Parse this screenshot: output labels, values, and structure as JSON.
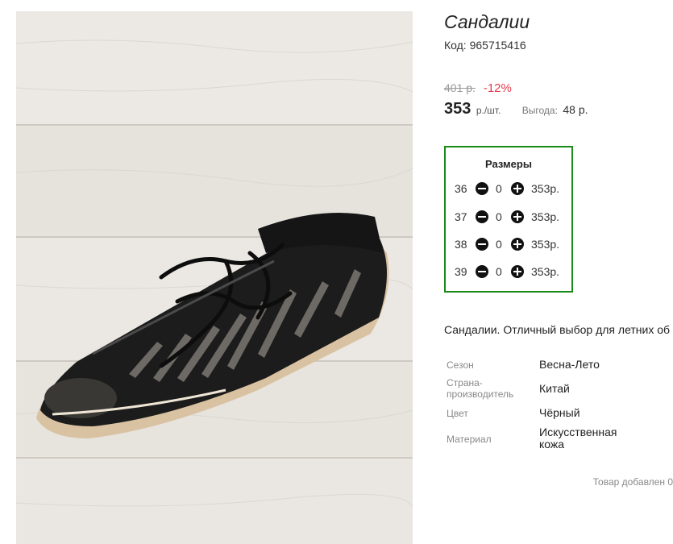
{
  "product": {
    "title": "Сандалии",
    "sku": "Код: 965715416",
    "old_price": "401 р.",
    "discount": "-12%",
    "price": "353",
    "price_unit": "р./шт.",
    "benefit_label": "Выгода:",
    "benefit_value": "48 р.",
    "image_alt": "black leather sandals photo"
  },
  "sizes": {
    "title": "Размеры",
    "rows": [
      {
        "size": "36",
        "qty": "0",
        "price": "353р."
      },
      {
        "size": "37",
        "qty": "0",
        "price": "353р."
      },
      {
        "size": "38",
        "qty": "0",
        "price": "353р."
      },
      {
        "size": "39",
        "qty": "0",
        "price": "353р."
      }
    ]
  },
  "description": "Сандалии. Отличный выбор для летних об",
  "attributes": [
    {
      "label": "Сезон",
      "value": "Весна-Лето"
    },
    {
      "label": "Страна-\nпроизводитель",
      "value": "Китай"
    },
    {
      "label": "Цвет",
      "value": "Чёрный"
    },
    {
      "label": "Материал",
      "value": "Искусственная\nкожа"
    }
  ],
  "added_note": "Товар добавлен 0",
  "colors": {
    "accent_green": "#1a8a1a",
    "discount_red": "#e23b4e"
  }
}
